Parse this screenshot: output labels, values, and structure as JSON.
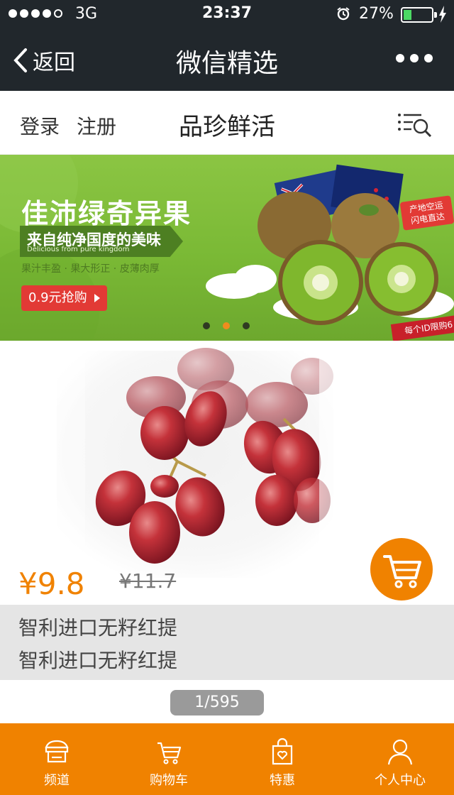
{
  "status_bar": {
    "signal_dots": 5,
    "signal_filled": 4,
    "network": "3G",
    "time": "23:37",
    "battery_percent": "27%",
    "battery_level": 0.27,
    "icons": [
      "alarm-icon",
      "battery-icon",
      "charging-icon"
    ]
  },
  "nav": {
    "back_label": "返回",
    "title": "微信精选",
    "more_icon": "more-dots-icon"
  },
  "header": {
    "login": "登录",
    "register": "注册",
    "brand": "品珍鲜活",
    "menu_icon": "list-search-icon"
  },
  "banner": {
    "title": "佳沛绿奇异果",
    "subtitle": "来自纯净国度的美味",
    "subtitle_en": "Delicious from pure kingdom",
    "features": "果汁丰盈 · 果大形正 · 皮薄肉厚",
    "cta": "0.9元抢购",
    "badge_line1": "产地空运",
    "badge_line2": "闪电直达",
    "limit": "每个ID限购6",
    "pager_count": 3,
    "pager_active": 1,
    "colors": {
      "bg": "#7ab935",
      "cta": "#e23a35",
      "active_dot": "#f08c1e"
    }
  },
  "product": {
    "image": "red-grapes-image",
    "price": "¥9.8",
    "old_price": "¥11.7",
    "name_line1": "智利进口无籽红提",
    "name_line2": "智利进口无籽红提",
    "cart_icon": "cart-icon",
    "counter": "1/595",
    "accent": "#f08200"
  },
  "tabbar": {
    "items": [
      {
        "label": "频道",
        "icon": "channel-icon"
      },
      {
        "label": "购物车",
        "icon": "cart-icon"
      },
      {
        "label": "特惠",
        "icon": "gift-bag-icon"
      },
      {
        "label": "个人中心",
        "icon": "user-icon"
      }
    ],
    "bg": "#f08200"
  }
}
